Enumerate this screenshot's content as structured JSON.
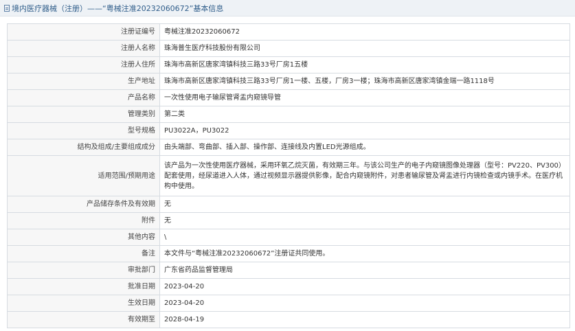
{
  "header": {
    "title": "境内医疗器械（注册）——“粤械注准20232060672”基本信息"
  },
  "rows": [
    {
      "label": "注册证编号",
      "value": "粤械注准20232060672"
    },
    {
      "label": "注册人名称",
      "value": "珠海普生医疗科技股份有限公司"
    },
    {
      "label": "注册人住所",
      "value": "珠海市高新区唐家湾镇科技三路33号厂房1五楼"
    },
    {
      "label": "生产地址",
      "value": "珠海市高新区唐家湾镇科技三路33号厂房1一楼、五楼，厂房3一楼；珠海市高新区唐家湾镇金瑞一路1118号"
    },
    {
      "label": "产品名称",
      "value": "一次性使用电子输尿管肾盂内窥镜导管"
    },
    {
      "label": "管理类别",
      "value": "第二类"
    },
    {
      "label": "型号规格",
      "value": "PU3022A，PU3022"
    },
    {
      "label": "结构及组成/主要组成成分",
      "value": "由头端部、弯曲部、插入部、操作部、连接线及内置LED光源组成。"
    },
    {
      "label": "适用范围/预期用途",
      "value": "该产品为一次性使用医疗器械，采用环氧乙烷灭菌，有效期三年。与该公司生产的电子内窥镜图像处理器（型号：PV220、PV300）配套使用，经尿道进入人体，通过视频显示器提供影像，配合内窥镜附件，对患者输尿管及肾盂进行内镜检查或内镜手术。在医疗机构中使用。"
    },
    {
      "label": "产品储存条件及有效期",
      "value": "无"
    },
    {
      "label": "附件",
      "value": "无"
    },
    {
      "label": "其他内容",
      "value": "\\"
    },
    {
      "label": "备注",
      "value": "本文件与“粤械注准20232060672”注册证共同使用。"
    },
    {
      "label": "审批部门",
      "value": "广东省药品监督管理局"
    },
    {
      "label": "批准日期",
      "value": "2023-04-20"
    },
    {
      "label": "生效日期",
      "value": "2023-04-20"
    },
    {
      "label": "有效期至",
      "value": "2028-04-19"
    }
  ]
}
